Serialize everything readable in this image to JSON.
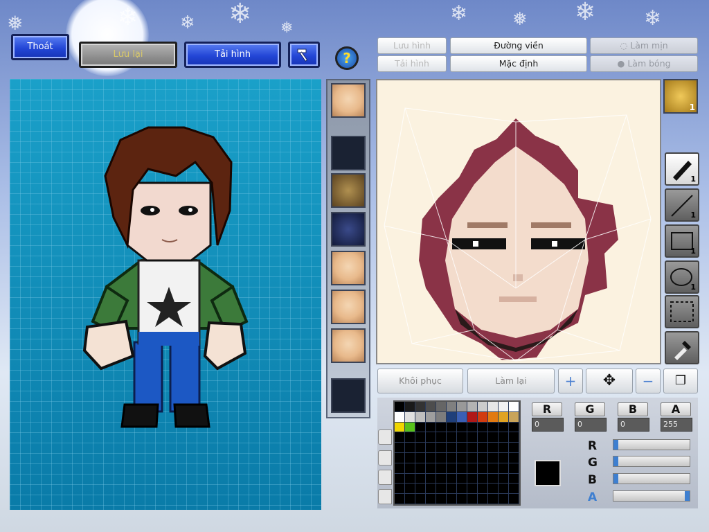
{
  "toolbar": {
    "exit_label": "Thoát",
    "save_label": "Lưu lại",
    "reload_label": "Tải hình",
    "hammer_icon": "hammer-icon"
  },
  "tabs": {
    "save_image": "Lưu hình",
    "load_image": "Tải hình",
    "outline": "Đường viền",
    "default": "Mặc định",
    "smooth": "Làm mịn",
    "shade": "Làm bóng"
  },
  "help_icon": "?",
  "editor_tools": {
    "pen_count": "1",
    "line_count": "1",
    "rect_count": "1",
    "ellipse_count": "1",
    "avatar_count": "1"
  },
  "actions": {
    "restore": "Khôi phục",
    "redo": "Làm lại"
  },
  "color": {
    "r_label": "R",
    "g_label": "G",
    "b_label": "B",
    "a_label": "A",
    "r_value": "0",
    "g_value": "0",
    "b_value": "0",
    "a_value": "255",
    "current": "#000000",
    "slider_r": 0,
    "slider_g": 0,
    "slider_b": 0,
    "slider_a": 1
  },
  "palette_colors": [
    "#000000",
    "#1a1a1a",
    "#333333",
    "#4d4d4d",
    "#666666",
    "#808080",
    "#999999",
    "#b3b3b3",
    "#cccccc",
    "#e6e6e6",
    "#f2f2f2",
    "#ffffff",
    "#ffffff",
    "#e0e0e0",
    "#bfbfbf",
    "#9e9e9e",
    "#7d7d7d",
    "#1f3f7a",
    "#3a5fb5",
    "#b01818",
    "#d23b10",
    "#e27a12",
    "#e0a323",
    "#c9a45a",
    "#f0d600",
    "#58c21a",
    "#000000",
    "#000000",
    "#000000",
    "#000000",
    "#000000",
    "#000000",
    "#000000",
    "#000000",
    "#000000",
    "#000000"
  ]
}
